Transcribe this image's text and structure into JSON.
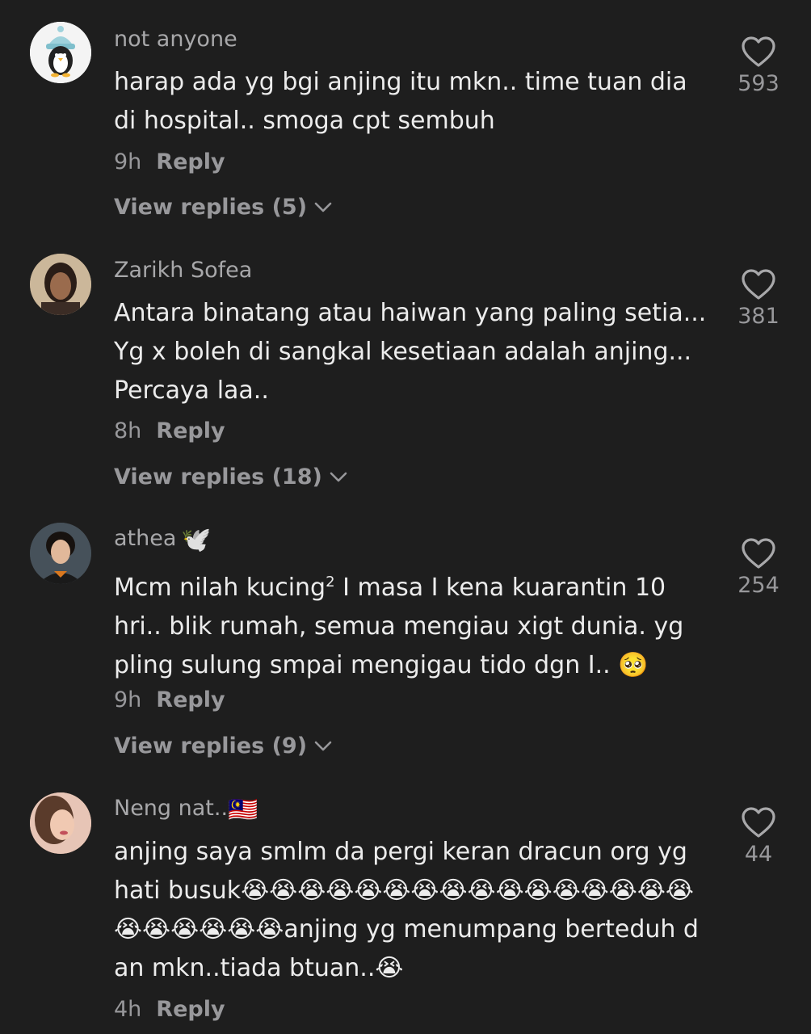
{
  "comments": [
    {
      "username": "not anyone",
      "username_suffix": "",
      "text": "harap ada yg bgi anjing itu mkn.. time tuan dia di hospital.. smoga cpt sembuh",
      "time": "9h",
      "reply_label": "Reply",
      "view_replies": "View replies (5)",
      "likes": "593",
      "avatar_icon": "penguin-beanie-avatar"
    },
    {
      "username": "Zarikh Sofea",
      "username_suffix": "",
      "text": "Antara binatang atau haiwan yang paling setia... Yg x boleh di sangkal kesetiaan adalah anjing... Percaya laa..",
      "time": "8h",
      "reply_label": "Reply",
      "view_replies": "View replies (18)",
      "likes": "381",
      "avatar_icon": "person-photo-avatar"
    },
    {
      "username": "athea",
      "username_suffix": "🕊️",
      "text_part1": "Mcm nilah kucing",
      "text_sup": "2",
      "text_part2": " I masa I kena kuarantin 10 hri.. blik rumah, semua mengiau xigt dunia. yg pling sulung smpai mengigau tido dgn I.. 🥺",
      "time": "9h",
      "reply_label": "Reply",
      "view_replies": "View replies (9)",
      "likes": "254",
      "avatar_icon": "person-photo-avatar"
    },
    {
      "username": "Neng nat..",
      "username_suffix": "🇲🇾",
      "text": "anjing saya smlm da pergi keran dracun org yg hati busuk😭😭😭😭😭😭😭😭😭😭😭😭😭😭😭😭😭😭😭😭😭😭anjing yg menumpang berteduh dan mkn..tiada btuan..😭",
      "time": "4h",
      "reply_label": "Reply",
      "likes": "44",
      "avatar_icon": "person-photo-avatar"
    }
  ]
}
